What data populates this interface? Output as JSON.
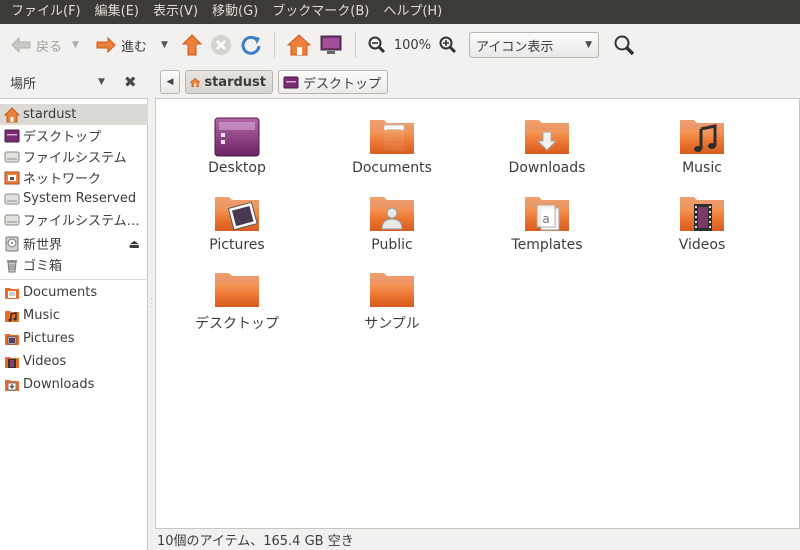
{
  "menubar": {
    "items": [
      "ファイル(F)",
      "編集(E)",
      "表示(V)",
      "移動(G)",
      "ブックマーク(B)",
      "ヘルプ(H)"
    ]
  },
  "toolbar": {
    "back_label": "戻る",
    "forward_label": "進む",
    "zoom_value": "100%",
    "view_mode": "アイコン表示"
  },
  "places": {
    "title": "場所",
    "devices": [
      {
        "label": "stardust",
        "icon": "home-icon",
        "selected": true
      },
      {
        "label": "デスクトップ",
        "icon": "desktop-icon"
      },
      {
        "label": "ファイルシステム",
        "icon": "drive-icon"
      },
      {
        "label": "ネットワーク",
        "icon": "network-icon"
      },
      {
        "label": "System Reserved",
        "icon": "drive-icon"
      },
      {
        "label": "ファイルシステム…",
        "icon": "drive-icon"
      },
      {
        "label": "新世界",
        "icon": "optical-disc-icon",
        "eject": true
      },
      {
        "label": "ゴミ箱",
        "icon": "trash-icon"
      }
    ],
    "bookmarks": [
      {
        "label": "Documents",
        "icon": "documents-folder-icon"
      },
      {
        "label": "Music",
        "icon": "music-folder-icon"
      },
      {
        "label": "Pictures",
        "icon": "pictures-folder-icon"
      },
      {
        "label": "Videos",
        "icon": "videos-folder-icon"
      },
      {
        "label": "Downloads",
        "icon": "downloads-folder-icon"
      }
    ]
  },
  "path": {
    "crumbs": [
      "stardust",
      "デスクトップ"
    ]
  },
  "files": [
    {
      "name": "Desktop",
      "type": "desktop"
    },
    {
      "name": "Documents",
      "type": "documents"
    },
    {
      "name": "Downloads",
      "type": "downloads"
    },
    {
      "name": "Music",
      "type": "music"
    },
    {
      "name": "Pictures",
      "type": "pictures"
    },
    {
      "name": "Public",
      "type": "public"
    },
    {
      "name": "Templates",
      "type": "templates"
    },
    {
      "name": "Videos",
      "type": "videos"
    },
    {
      "name": "デスクトップ",
      "type": "folder"
    },
    {
      "name": "サンプル",
      "type": "folder"
    }
  ],
  "status": {
    "text": "10個のアイテム、165.4 GB 空き"
  },
  "colors": {
    "menubar_bg": "#3c3b37",
    "folder_orange": "#e96c2a",
    "desktop_purple": "#7b2d74"
  }
}
